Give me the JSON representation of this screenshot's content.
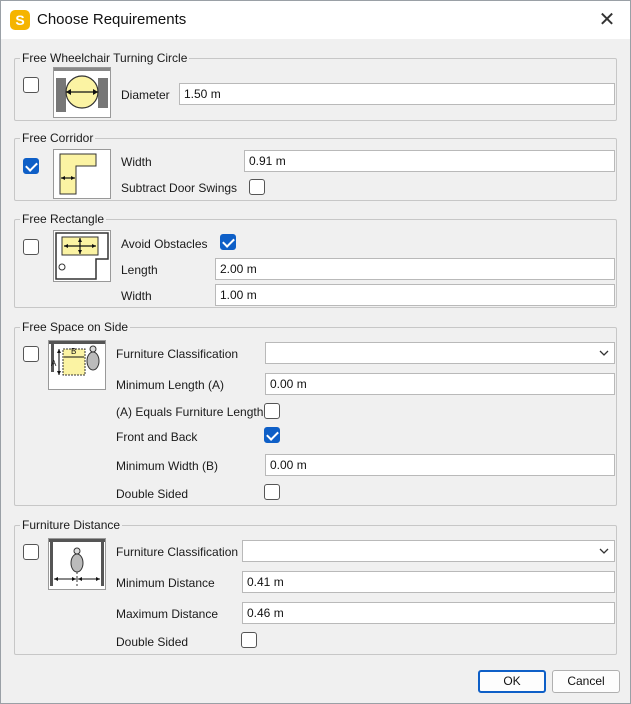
{
  "window": {
    "title": "Choose Requirements",
    "app_icon_letter": "S",
    "close_glyph": "✕"
  },
  "wheelchair": {
    "legend": "Free Wheelchair Turning Circle",
    "checked": false,
    "diameter_label": "Diameter",
    "diameter_value": "1.50 m"
  },
  "corridor": {
    "legend": "Free Corridor",
    "checked": true,
    "width_label": "Width",
    "width_value": "0.91 m",
    "subtract_label": "Subtract Door Swings",
    "subtract_checked": false
  },
  "rectangle": {
    "legend": "Free Rectangle",
    "checked": false,
    "avoid_label": "Avoid Obstacles",
    "avoid_checked": true,
    "length_label": "Length",
    "length_value": "2.00 m",
    "width_label": "Width",
    "width_value": "1.00 m"
  },
  "side": {
    "legend": "Free Space on Side",
    "checked": false,
    "furn_label": "Furniture Classification",
    "furn_value": "",
    "minlen_label": "Minimum Length (A)",
    "minlen_value": "0.00 m",
    "equals_label": "(A) Equals Furniture Length",
    "equals_checked": false,
    "frontback_label": "Front and Back",
    "frontback_checked": true,
    "minwidth_label": "Minimum Width (B)",
    "minwidth_value": "0.00 m",
    "double_label": "Double Sided",
    "double_checked": false,
    "illus_a": "A",
    "illus_b": "B"
  },
  "distance": {
    "legend": "Furniture Distance",
    "checked": false,
    "furn_label": "Furniture Classification",
    "furn_value": "",
    "mindist_label": "Minimum Distance",
    "mindist_value": "0.41 m",
    "maxdist_label": "Maximum Distance",
    "maxdist_value": "0.46 m",
    "double_label": "Double Sided",
    "double_checked": false
  },
  "buttons": {
    "ok": "OK",
    "cancel": "Cancel"
  },
  "colors": {
    "accent": "#0e5fc7",
    "illustration_fill": "#fbf3a3"
  }
}
